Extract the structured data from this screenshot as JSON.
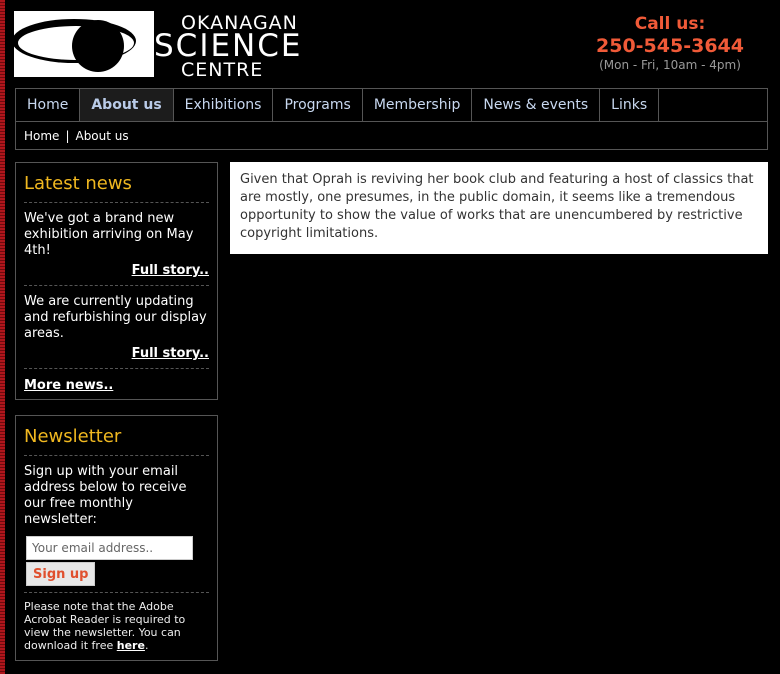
{
  "header": {
    "logo": {
      "line1": "OKANAGAN",
      "line2": "SCIENCE",
      "line3": "CENTRE"
    },
    "call_label": "Call us:",
    "phone": "250-545-3644",
    "hours": "(Mon - Fri, 10am - 4pm)"
  },
  "nav": {
    "tabs": [
      {
        "label": "Home"
      },
      {
        "label": "About us"
      },
      {
        "label": "Exhibitions"
      },
      {
        "label": "Programs"
      },
      {
        "label": "Membership"
      },
      {
        "label": "News & events"
      },
      {
        "label": "Links"
      }
    ],
    "active_index": 1,
    "breadcrumb": {
      "home": "Home",
      "separator": "|",
      "current": "About us"
    }
  },
  "latest_news": {
    "title": "Latest news",
    "items": [
      {
        "text": "We've got a brand new exhibition arriving on May 4th!",
        "link": "Full story.."
      },
      {
        "text": "We are currently updating and refurbishing our display areas.",
        "link": "Full story.."
      }
    ],
    "more": "More news.."
  },
  "newsletter": {
    "title": "Newsletter",
    "intro": "Sign up with your email address below to receive our free monthly newsletter:",
    "input_value": "Your email address..",
    "button": "Sign up",
    "note_pre": "Please note that the Adobe Acrobat Reader is required to view the newsletter. You can download it free ",
    "note_link": "here",
    "note_post": "."
  },
  "main": {
    "paragraph": "Given that Oprah is reviving her book club and featuring a host of classics that are mostly, one presumes, in the public domain, it seems like a tremendous opportunity to show the value of works that are unencumbered by restrictive copyright limitations."
  },
  "colors": {
    "accent_orange": "#f05a38",
    "heading_gold": "#f0b820",
    "nav_text": "#c8d8f0",
    "background": "#000000"
  }
}
